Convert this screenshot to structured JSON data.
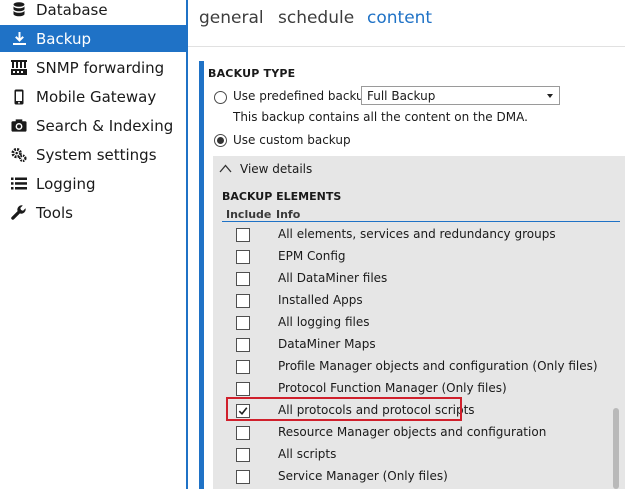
{
  "sidebar": {
    "items": [
      {
        "label": "Database",
        "icon": "database-icon"
      },
      {
        "label": "Backup",
        "icon": "download-icon",
        "active": true
      },
      {
        "label": "SNMP forwarding",
        "icon": "snmp-icon"
      },
      {
        "label": "Mobile Gateway",
        "icon": "mobile-icon"
      },
      {
        "label": "Search & Indexing",
        "icon": "search-camera-icon"
      },
      {
        "label": "System settings",
        "icon": "gears-icon"
      },
      {
        "label": "Logging",
        "icon": "list-icon"
      },
      {
        "label": "Tools",
        "icon": "wrench-icon"
      }
    ]
  },
  "tabs": [
    {
      "label": "general"
    },
    {
      "label": "schedule"
    },
    {
      "label": "content",
      "active": true
    }
  ],
  "backup_type": {
    "title": "BACKUP TYPE",
    "predefined_label": "Use predefined backup:",
    "predefined_value": "Full Backup",
    "description": "This backup contains all the content on the DMA.",
    "custom_label": "Use custom backup",
    "selected": "custom"
  },
  "details": {
    "toggle_label": "View details",
    "elements_title": "BACKUP ELEMENTS",
    "columns": [
      "Include",
      "Info"
    ],
    "rows": [
      {
        "label": "All elements, services and redundancy groups",
        "checked": false
      },
      {
        "label": "EPM Config",
        "checked": false
      },
      {
        "label": "All DataMiner files",
        "checked": false
      },
      {
        "label": "Installed Apps",
        "checked": false
      },
      {
        "label": "All logging files",
        "checked": false
      },
      {
        "label": "DataMiner Maps",
        "checked": false
      },
      {
        "label": "Profile Manager objects and configuration (Only files)",
        "checked": false
      },
      {
        "label": "Protocol Function Manager (Only files)",
        "checked": false
      },
      {
        "label": "All protocols and protocol scripts",
        "checked": true
      },
      {
        "label": "Resource Manager objects and configuration",
        "checked": false
      },
      {
        "label": "All scripts",
        "checked": false
      },
      {
        "label": "Service Manager (Only files)",
        "checked": false
      }
    ]
  },
  "colors": {
    "accent": "#1f72c6",
    "highlight": "#d0202c"
  }
}
